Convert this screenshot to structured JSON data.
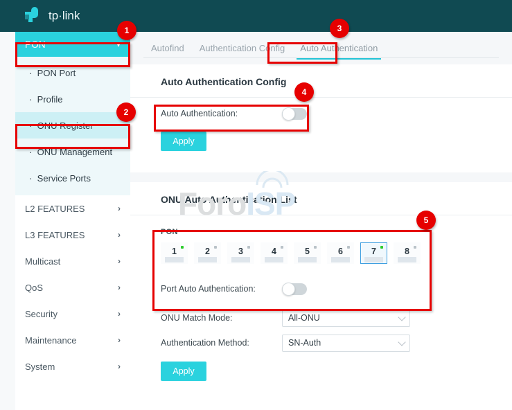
{
  "header": {
    "brand": "tp-link",
    "brand_icon": "tplink-logo-icon",
    "bg_color": "#104a52",
    "logo_color": "#2ad2de"
  },
  "sidebar": {
    "group": {
      "label": "PON",
      "expanded": true,
      "chevron_icon": "chevron-down-icon",
      "bg_color": "#2ad2de"
    },
    "sub_items": [
      {
        "label": "PON Port",
        "active": false,
        "bullet_icon": "bullet-dot-icon"
      },
      {
        "label": "Profile",
        "active": false,
        "bullet_icon": "bullet-dot-icon"
      },
      {
        "label": "ONU Register",
        "active": true,
        "bullet_icon": "bullet-dot-icon"
      },
      {
        "label": "ONU Management",
        "active": false,
        "bullet_icon": "bullet-dot-icon"
      },
      {
        "label": "Service Ports",
        "active": false,
        "bullet_icon": "bullet-dot-icon"
      }
    ],
    "items": [
      {
        "label": "L2 FEATURES",
        "arrow_icon": "chevron-right-icon"
      },
      {
        "label": "L3 FEATURES",
        "arrow_icon": "chevron-right-icon"
      },
      {
        "label": "Multicast",
        "arrow_icon": "chevron-right-icon"
      },
      {
        "label": "QoS",
        "arrow_icon": "chevron-right-icon"
      },
      {
        "label": "Security",
        "arrow_icon": "chevron-right-icon"
      },
      {
        "label": "Maintenance",
        "arrow_icon": "chevron-right-icon"
      },
      {
        "label": "System",
        "arrow_icon": "chevron-right-icon"
      }
    ]
  },
  "tabs": [
    {
      "label": "Autofind",
      "active": false
    },
    {
      "label": "Authentication Config",
      "active": false
    },
    {
      "label": "Auto Authentication",
      "active": true
    }
  ],
  "auth_config_card": {
    "title": "Auto Authentication Config",
    "toggle_label": "Auto Authentication:",
    "toggle_state": "off",
    "apply_label": "Apply"
  },
  "auth_list_card": {
    "title": "ONU Auto Authentication List",
    "pon_label": "PON",
    "ports": [
      {
        "number": "1",
        "led": "on",
        "selected": false
      },
      {
        "number": "2",
        "led": "off",
        "selected": false
      },
      {
        "number": "3",
        "led": "off",
        "selected": false
      },
      {
        "number": "4",
        "led": "off",
        "selected": false
      },
      {
        "number": "5",
        "led": "off",
        "selected": false
      },
      {
        "number": "6",
        "led": "off",
        "selected": false
      },
      {
        "number": "7",
        "led": "on",
        "selected": true
      },
      {
        "number": "8",
        "led": "off",
        "selected": false
      }
    ],
    "port_toggle_label": "Port Auto Authentication:",
    "port_toggle_state": "off",
    "match_mode_label": "ONU Match Mode:",
    "match_mode_value": "All-ONU",
    "match_mode_options": [
      "All-ONU"
    ],
    "auth_method_label": "Authentication Method:",
    "auth_method_value": "SN-Auth",
    "auth_method_options": [
      "SN-Auth"
    ],
    "apply_label": "Apply"
  },
  "watermark": {
    "part1": "Foro",
    "part2": "ISP",
    "color1": "#dcdedf",
    "color2": "#d9e8f4",
    "arc_icon": "wifi-arc-icon"
  },
  "annotations": {
    "color": "#e60000",
    "badges": [
      {
        "number": "1",
        "target": "sidebar-group-pon"
      },
      {
        "number": "2",
        "target": "sidebar-item-onu-register"
      },
      {
        "number": "3",
        "target": "tab-auto-authentication"
      },
      {
        "number": "4",
        "target": "auto-authentication-toggle-row"
      },
      {
        "number": "5",
        "target": "pon-port-selector-block"
      }
    ]
  }
}
